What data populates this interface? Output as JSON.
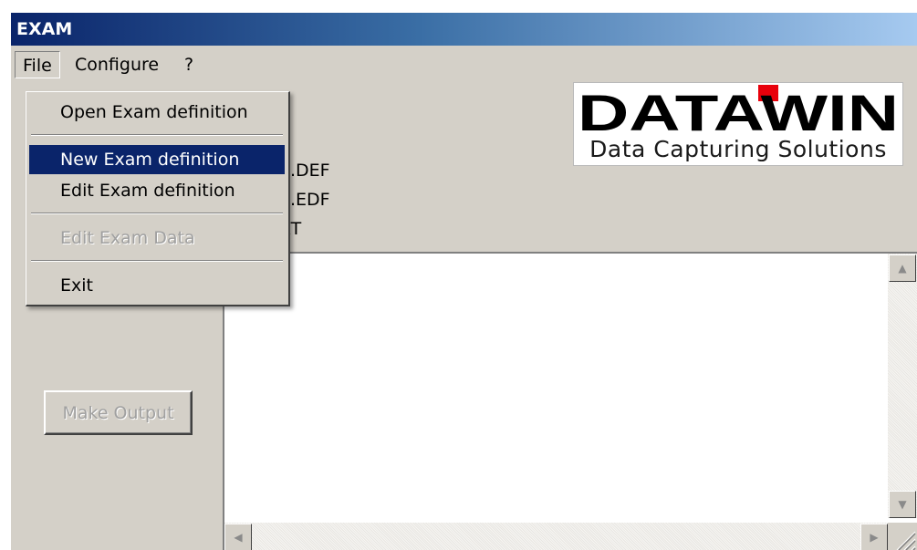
{
  "window": {
    "title": "EXAM"
  },
  "menubar": {
    "items": [
      "File",
      "Configure",
      "?"
    ]
  },
  "file_menu": {
    "items": [
      {
        "label": "Open Exam definition"
      },
      {
        "label": "New Exam definition",
        "selected": true
      },
      {
        "label": "Edit Exam definition"
      },
      {
        "label": "Edit Exam Data",
        "disabled": true
      },
      {
        "label": "Exit"
      }
    ]
  },
  "logo": {
    "brand": "DATAWIN",
    "tagline": "Data Capturing Solutions",
    "accent_color": "#e8000b"
  },
  "info": {
    "lines": [
      "E.DEF",
      "E.EDF",
      "XT"
    ]
  },
  "buttons": {
    "make_output": "Make Output"
  },
  "colors": {
    "title_start": "#0a246a",
    "title_end": "#a6caf0",
    "face": "#d4d0c8",
    "selection": "#0a246a"
  }
}
